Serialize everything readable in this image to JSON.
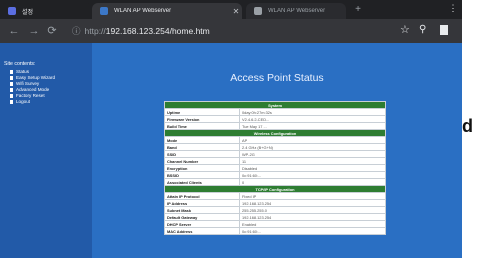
{
  "browser": {
    "tabs": [
      {
        "title": "설정",
        "favicon_color": "#5b6ee1",
        "active": false
      },
      {
        "title": "WLAN AP Webserver",
        "favicon_color": "#3c78c8",
        "active": true
      },
      {
        "title": "WLAN AP Webserver",
        "favicon_color": "#9aa0a6",
        "active": false
      }
    ],
    "new_tab_icon": "plus-icon",
    "menu_icon": "more-vert-icon",
    "address": {
      "scheme": "http://",
      "rest": "192.168.123.254/home.htm"
    }
  },
  "sidebar": {
    "title": "Site contents:",
    "items": [
      {
        "label": "Status"
      },
      {
        "label": "Easy Setup Wizard"
      },
      {
        "label": "Wifi Survey"
      },
      {
        "label": "Advanced Mode"
      },
      {
        "label": "Factory Reset"
      },
      {
        "label": "Logout"
      }
    ]
  },
  "main": {
    "title": "Access Point Status",
    "rows": [
      {
        "type": "header",
        "label": "System"
      },
      {
        "type": "row",
        "label": "Uptime",
        "value": "0day:0h:27m:32s"
      },
      {
        "type": "row",
        "label": "Firmware Version",
        "value": "V2.4.6.2-CED..."
      },
      {
        "type": "row",
        "label": "Build Time",
        "value": "Tue May 17 ..."
      },
      {
        "type": "header",
        "label": "Wireless Configuration"
      },
      {
        "type": "row",
        "label": "Mode",
        "value": "AP"
      },
      {
        "type": "row",
        "label": "Band",
        "value": "2.4 GHz (B+G+N)"
      },
      {
        "type": "row",
        "label": "SSID",
        "value": "WP-2G"
      },
      {
        "type": "row",
        "label": "Channel Number",
        "value": "11"
      },
      {
        "type": "row",
        "label": "Encryption",
        "value": "Disabled"
      },
      {
        "type": "row",
        "label": "BSSID",
        "value": "0c:91:60:..."
      },
      {
        "type": "row",
        "label": "Associated Clients",
        "value": "0"
      },
      {
        "type": "header",
        "label": "TCP/IP Configuration"
      },
      {
        "type": "row",
        "label": "Attain IP Protocol",
        "value": "Fixed IP"
      },
      {
        "type": "row",
        "label": "IP Address",
        "value": "192.168.123.254"
      },
      {
        "type": "row",
        "label": "Subnet Mask",
        "value": "255.255.255.0"
      },
      {
        "type": "row",
        "label": "Default Gateway",
        "value": "192.168.123.254"
      },
      {
        "type": "row",
        "label": "DHCP Server",
        "value": "Enabled"
      },
      {
        "type": "row",
        "label": "MAC Address",
        "value": "0c:91:60:..."
      }
    ]
  },
  "cropped_text": "d",
  "colors": {
    "sidebar": "#225aa8",
    "content": "#2a6fc3",
    "section_header": "#2e7d32"
  }
}
